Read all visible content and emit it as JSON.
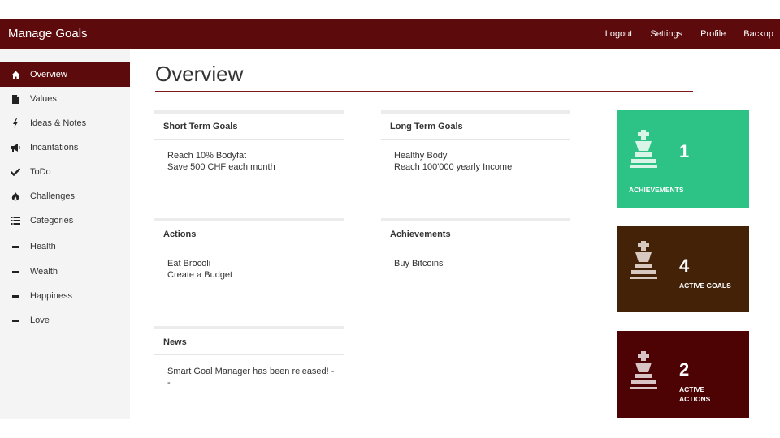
{
  "navbar": {
    "brand": "Manage Goals",
    "links": [
      "Logout",
      "Settings",
      "Profile",
      "Backup"
    ]
  },
  "sidebar": {
    "items": [
      {
        "label": "Overview",
        "icon": "home-icon",
        "active": true
      },
      {
        "label": "Values",
        "icon": "file-icon"
      },
      {
        "label": "Ideas & Notes",
        "icon": "bolt-icon"
      },
      {
        "label": "Incantations",
        "icon": "bullhorn-icon"
      },
      {
        "label": "ToDo",
        "icon": "check-icon"
      },
      {
        "label": "Challenges",
        "icon": "fire-icon"
      },
      {
        "label": "Categories",
        "icon": "list-icon"
      },
      {
        "label": "Health",
        "icon": "minus-icon"
      },
      {
        "label": "Wealth",
        "icon": "minus-icon"
      },
      {
        "label": "Happiness",
        "icon": "minus-icon"
      },
      {
        "label": "Love",
        "icon": "minus-icon"
      }
    ]
  },
  "main": {
    "title": "Overview",
    "panels": {
      "short_term": {
        "title": "Short Term Goals",
        "lines": [
          "Reach 10% Bodyfat",
          "Save 500 CHF each month"
        ]
      },
      "long_term": {
        "title": "Long Term Goals",
        "lines": [
          "Healthy Body",
          "Reach 100'000 yearly Income"
        ]
      },
      "actions": {
        "title": "Actions",
        "lines": [
          "Eat Brocoli",
          "Create a Budget"
        ]
      },
      "achievements": {
        "title": "Achievements",
        "lines": [
          "Buy Bitcoins"
        ]
      },
      "news": {
        "title": "News",
        "lines": [
          "Smart Goal Manager has been released! -\n-"
        ]
      }
    }
  },
  "stats": [
    {
      "value": "1",
      "label": "ACHIEVEMENTS",
      "color": "#2ec386",
      "icon": "chess-king-icon"
    },
    {
      "value": "4",
      "label": "ACTIVE GOALS",
      "color": "#442208",
      "icon": "chess-king-icon"
    },
    {
      "value": "2",
      "label": "ACTIVE\nACTIONS",
      "color": "#4d0304",
      "icon": "chess-king-icon"
    }
  ],
  "colors": {
    "navbar": "#5c0a0c",
    "sidebar_bg": "#f4f4f4",
    "active_item": "#5c0a0c"
  }
}
